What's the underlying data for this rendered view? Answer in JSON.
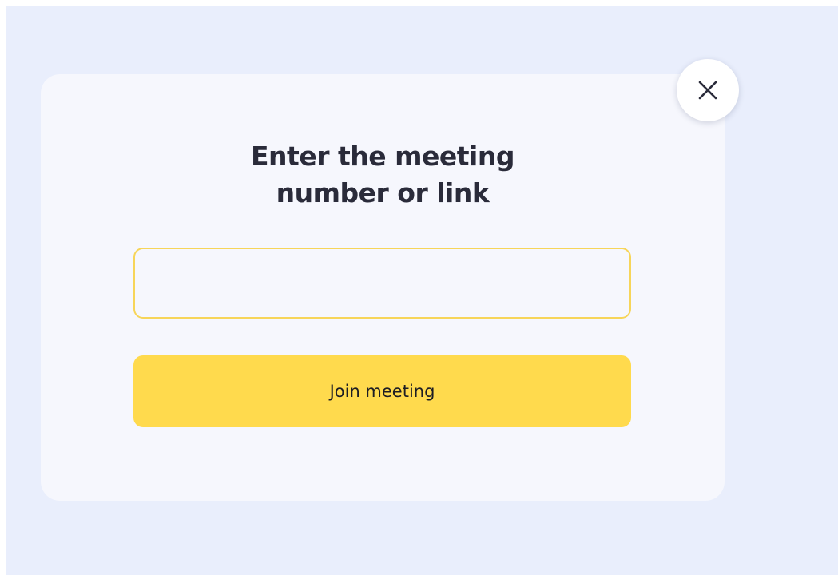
{
  "dialog": {
    "title_line1": "Enter the meeting",
    "title_line2": "number or link",
    "input": {
      "value": "",
      "placeholder": ""
    },
    "join_label": "Join meeting",
    "close_icon": "close-icon"
  },
  "colors": {
    "backdrop": "#e9eefc",
    "dialog": "#f6f7fd",
    "accent": "#ffda4d",
    "input_border": "#f7d559",
    "title_text": "#2a2b3a"
  }
}
